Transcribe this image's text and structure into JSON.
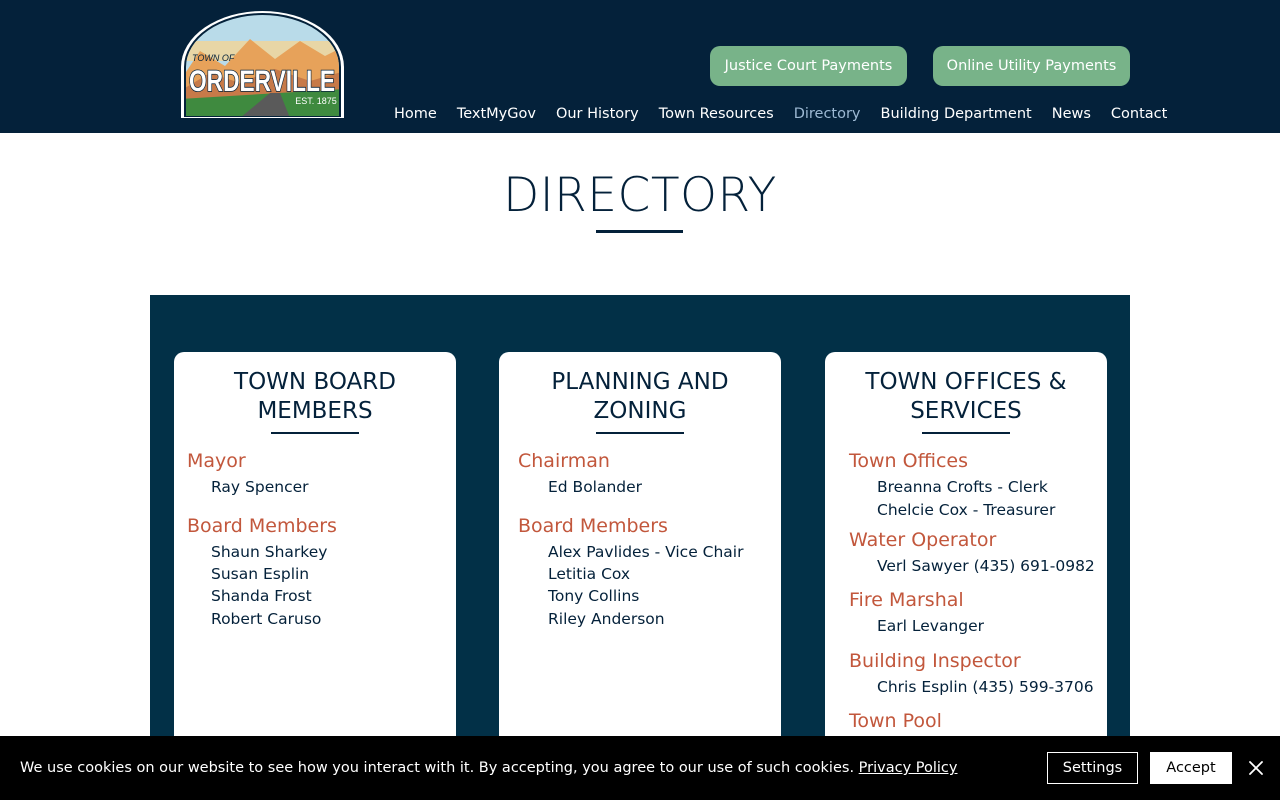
{
  "header": {
    "logo": {
      "small_text": "TOWN OF",
      "name": "ORDERVILLE",
      "est": "EST. 1875"
    },
    "buttons": {
      "justice": "Justice Court Payments",
      "utility": "Online Utility Payments"
    },
    "nav": [
      {
        "label": "Home"
      },
      {
        "label": "TextMyGov"
      },
      {
        "label": "Our History"
      },
      {
        "label": "Town Resources"
      },
      {
        "label": "Directory"
      },
      {
        "label": "Building Department"
      },
      {
        "label": "News"
      },
      {
        "label": "Contact"
      }
    ]
  },
  "page": {
    "title": "DIRECTORY"
  },
  "cards": {
    "board": {
      "heading_line1": "TOWN BOARD",
      "heading_line2": "MEMBERS",
      "mayor": {
        "role": "Mayor",
        "people": [
          "Ray Spencer"
        ]
      },
      "members": {
        "role": "Board Members",
        "people": [
          "Shaun Sharkey",
          "Susan Esplin",
          "Shanda Frost",
          "Robert Caruso"
        ]
      }
    },
    "planning": {
      "heading_line1": "PLANNING AND",
      "heading_line2": "ZONING",
      "chairman": {
        "role": "Chairman",
        "people": [
          "Ed Bolander"
        ]
      },
      "members": {
        "role": "Board Members",
        "people": [
          "Alex Pavlides - Vice Chair",
          "Letitia Cox",
          "Tony Collins",
          "Riley Anderson"
        ]
      }
    },
    "offices": {
      "heading_line1": "TOWN OFFICES &",
      "heading_line2": "SERVICES",
      "town_offices": {
        "role": "Town Offices",
        "people": [
          "Breanna Crofts - Clerk",
          "Chelcie Cox - Treasurer"
        ]
      },
      "water": {
        "role": "Water Operator",
        "people": [
          "Verl Sawyer (435) 691-0982"
        ]
      },
      "fire": {
        "role": "Fire Marshal",
        "people": [
          "Earl Levanger"
        ]
      },
      "building": {
        "role": "Building Inspector",
        "people": [
          "Chris Esplin (435) 599-3706"
        ]
      },
      "pool": {
        "role": "Town Pool"
      }
    }
  },
  "cookie": {
    "text": "We use cookies on our website to see how you interact with it. By accepting, you agree to our use of such cookies.",
    "link": "Privacy Policy",
    "settings": "Settings",
    "accept": "Accept"
  },
  "icons": {
    "close": "close-icon"
  },
  "colors": {
    "header_bg": "#04213a",
    "panel_bg": "#023047",
    "button_green": "#78b389",
    "role_color": "#c2573c",
    "nav_active": "#9db9d3"
  }
}
